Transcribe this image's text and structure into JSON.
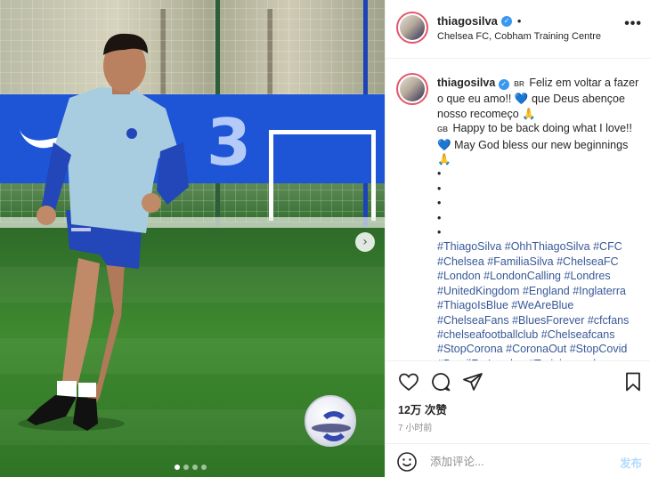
{
  "header": {
    "username": "thiagosilva",
    "separator": "•",
    "location": "Chelsea FC, Cobham Training Centre",
    "more_label": "•••"
  },
  "caption": {
    "username": "thiagosilva",
    "flag_br": "BR",
    "line_pt_1": "Feliz em voltar a fazer o que eu amo!!",
    "heart": "💙",
    "line_pt_2": "que Deus abençoe nosso recomeço",
    "pray": "🙏",
    "flag_gb": "GB",
    "line_en_1": "Happy to be back doing what I love!!",
    "line_en_2": "May God bless our new beginnings",
    "bullets": [
      "•",
      "•",
      "•",
      "•",
      "•"
    ],
    "hashtags": "#ThiagoSilva #OhhThiagoSilva #CFC #Chelsea #FamiliaSilva #ChelseaFC #London #LondonCalling #Londres #UnitedKingdom #England #Inglaterra #ThiagoIsBlue #WeAreBlue #ChelseaFans #BluesForever #cfcfans #chelseafootballclub #Chelseafcans #StopCorona #CoronaOut #StopCovid #BrazilForLondon #Trainingmode"
  },
  "photo": {
    "next_arrow": "›",
    "carousel_count": 4,
    "carousel_active": 1
  },
  "actions": {
    "likes": "12万 次赞",
    "time": "7 小时前"
  },
  "comment": {
    "placeholder": "添加评论...",
    "post_label": "发布"
  },
  "colors": {
    "accent_blue": "#3897f0",
    "hashtag": "#385898",
    "post_disabled": "#b3dbff",
    "story_ring": "#e2566b"
  }
}
